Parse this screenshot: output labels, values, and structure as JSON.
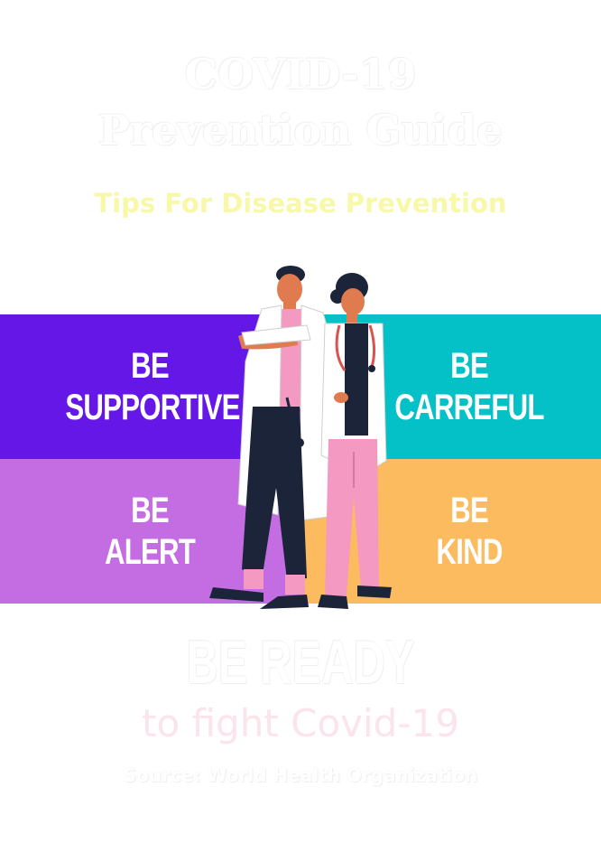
{
  "header": {
    "title_line1": "COVID-19",
    "title_line2": "Prevention Guide",
    "subtitle": "Tips For Disease Prevention"
  },
  "panels": [
    {
      "line1": "BE",
      "line2": "SUPPORTIVE",
      "color": "#6417e6"
    },
    {
      "line1": "BE",
      "line2": "CARREFUL",
      "color": "#04c0c7"
    },
    {
      "line1": "BE",
      "line2": "ALERT",
      "color": "#c46ce2"
    },
    {
      "line1": "BE",
      "line2": "KIND",
      "color": "#fbbb5e"
    }
  ],
  "illustration": {
    "icon": "doctors-illustration"
  },
  "footer": {
    "ready": "BE READY",
    "fight": "to fight Covid-19",
    "source": "Source: World Health Organization"
  }
}
